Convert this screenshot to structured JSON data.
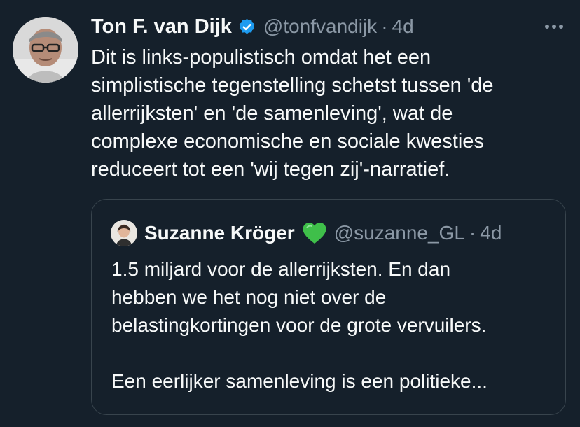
{
  "tweet": {
    "author_name": "Ton F. van Dijk",
    "author_handle": "@tonfvandijk",
    "separator": "·",
    "timestamp": "4d",
    "avatar_icon": "person-avatar",
    "verified_icon": "verified-badge-icon",
    "verified_color": "#1d9bf0",
    "more_icon": "more-options-icon",
    "text_lines": [
      "Dit is links-populistisch omdat het een",
      "simplistische tegenstelling schetst tussen 'de",
      "allerrijksten' en 'de samenleving', wat de",
      "complexe economische en sociale kwesties",
      "reduceert tot een 'wij tegen zij'-narratief."
    ]
  },
  "quote": {
    "author_name": "Suzanne Kröger",
    "author_handle": "@suzanne_GL",
    "separator": "·",
    "timestamp": "4d",
    "avatar_icon": "person-avatar",
    "heart_icon": "green-heart-icon",
    "heart_color": "#3fbf4a",
    "text_lines": [
      "1.5 miljard voor de allerrijksten. En dan",
      "hebben we het nog niet over de",
      "belastingkortingen voor de grote vervuilers.",
      "",
      "Een eerlijker samenleving is een politieke..."
    ]
  },
  "colors": {
    "background": "#15202b",
    "text": "#f7f9f9",
    "muted": "#8b98a5",
    "border": "#38444d"
  }
}
